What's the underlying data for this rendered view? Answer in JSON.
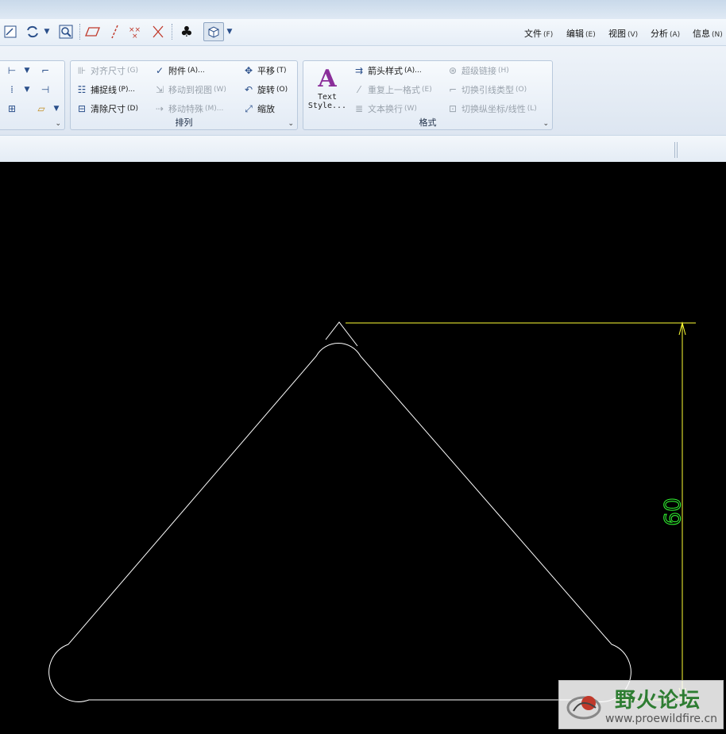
{
  "menubar": {
    "items": [
      {
        "label": "文件",
        "key": "(F)"
      },
      {
        "label": "编辑",
        "key": "(E)"
      },
      {
        "label": "视图",
        "key": "(V)"
      },
      {
        "label": "分析",
        "key": "(A)"
      },
      {
        "label": "信息",
        "key": "(N)"
      }
    ]
  },
  "quick_toolbar": {
    "icons": [
      "sketch-icon",
      "regenerate-icon",
      "dropdown-arrow-icon",
      "zoom-icon",
      "datum-plane-icon",
      "datum-axis-icon",
      "datum-point-icon",
      "datum-csys-icon",
      "club-icon",
      "display-style-icon",
      "dropdown-arrow-icon"
    ]
  },
  "ribbon": {
    "arrange_group": {
      "label": "排列",
      "buttons": [
        {
          "label": "对齐尺寸",
          "key": "(G)",
          "enabled": false
        },
        {
          "label": "附件",
          "key": "(A)...",
          "enabled": true
        },
        {
          "label": "平移",
          "key": "(T)",
          "enabled": true
        },
        {
          "label": "捕捉线",
          "key": "(P)...",
          "enabled": true
        },
        {
          "label": "移动到视图",
          "key": "(W)",
          "enabled": false
        },
        {
          "label": "旋转",
          "key": "(O)",
          "enabled": true
        },
        {
          "label": "清除尺寸",
          "key": "(D)",
          "enabled": true
        },
        {
          "label": "移动特殊",
          "key": "(M)...",
          "enabled": false
        },
        {
          "label": "缩放",
          "key": "",
          "enabled": true
        }
      ]
    },
    "format_group": {
      "label": "格式",
      "text_style": {
        "glyph": "A",
        "line1": "Text",
        "line2": "Style..."
      },
      "buttons": [
        {
          "label": "箭头样式",
          "key": "(A)...",
          "enabled": true
        },
        {
          "label": "超级链接",
          "key": "(H)",
          "enabled": false
        },
        {
          "label": "重复上一格式",
          "key": "(E)",
          "enabled": false
        },
        {
          "label": "切换引线类型",
          "key": "(O)",
          "enabled": false
        },
        {
          "label": "文本换行",
          "key": "(W)",
          "enabled": false
        },
        {
          "label": "切换纵坐标/线性",
          "key": "(L)",
          "enabled": false
        }
      ]
    }
  },
  "drawing": {
    "dimension_value": "60",
    "line_color": "#ffffff",
    "dimension_color": "#ffff33",
    "dimension_text_color": "#33ff33"
  },
  "watermark": {
    "title": "野火论坛",
    "url": "www.proewildfire.cn"
  }
}
